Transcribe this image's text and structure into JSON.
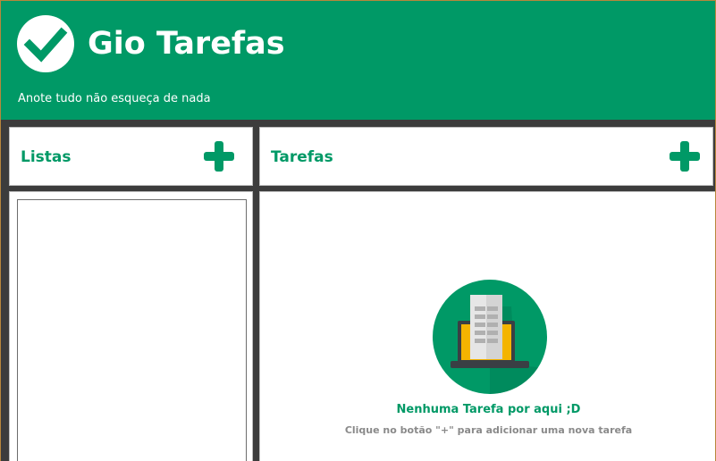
{
  "header": {
    "title": "Gio Tarefas",
    "subtitle": "Anote tudo não esqueça de nada",
    "logo_icon": "check-icon",
    "bg_color": "#009966"
  },
  "lists_panel": {
    "title": "Listas",
    "add_icon": "plus-icon"
  },
  "tasks_panel": {
    "title": "Tarefas",
    "add_icon": "plus-icon",
    "empty_state": {
      "icon": "laptop-document-icon",
      "title": "Nenhuma Tarefa por aqui ;D",
      "hint": "Clique no botão \"+\" para adicionar uma nova tarefa"
    }
  },
  "colors": {
    "accent": "#009966",
    "background": "#3c3c3c",
    "hint_text": "#8a8a8a"
  }
}
